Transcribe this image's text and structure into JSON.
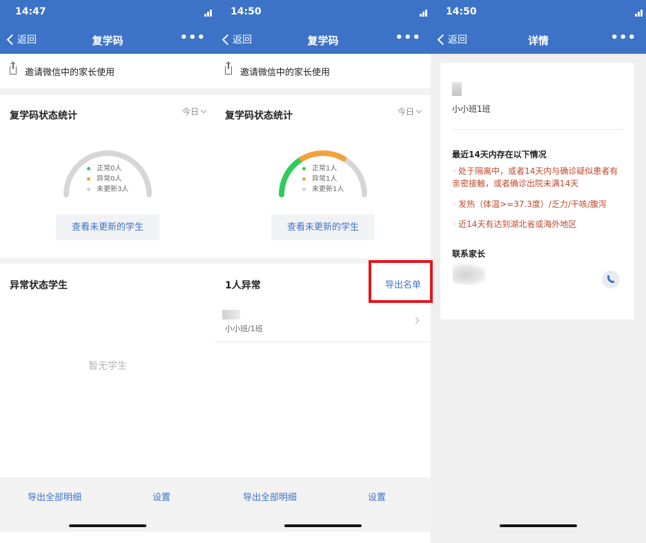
{
  "colors": {
    "brand": "#3c73c7",
    "normal": "#2ecc5a",
    "abnormal": "#f2a23a",
    "not_updated": "#d6d6d6",
    "alert": "#c0472a"
  },
  "screens": [
    {
      "time": "14:47",
      "nav": {
        "back": "返回",
        "title": "复学码",
        "more": "•••"
      },
      "invite": "邀请微信中的家长使用",
      "stats": {
        "title": "复学码状态统计",
        "range": "今日",
        "gauge": {
          "normal": 0,
          "abnormal": 0,
          "not_updated": 3
        },
        "legend": [
          "正常0人",
          "异常0人",
          "未更新3人"
        ],
        "button": "查看未更新的学生"
      },
      "abnormal": {
        "title": "异常状态学生",
        "empty": "暂无学生"
      },
      "bottom": {
        "export_all": "导出全部明细",
        "settings": "设置"
      }
    },
    {
      "time": "14:50",
      "nav": {
        "back": "返回",
        "title": "复学码",
        "more": "•••"
      },
      "invite": "邀请微信中的家长使用",
      "stats": {
        "title": "复学码状态统计",
        "range": "今日",
        "gauge": {
          "normal": 1,
          "abnormal": 1,
          "not_updated": 1
        },
        "legend": [
          "正常1人",
          "异常1人",
          "未更新1人"
        ],
        "button": "查看未更新的学生"
      },
      "abnormal": {
        "title": "1人异常",
        "export": "导出名单",
        "student_class": "小小班/1班"
      },
      "bottom": {
        "export_all": "导出全部明细",
        "settings": "设置"
      }
    },
    {
      "time": "14:50",
      "nav": {
        "back": "返回",
        "title": "详情",
        "more": "•••"
      },
      "detail": {
        "class": "小小班1班",
        "section_title": "最近14天内存在以下情况",
        "items": [
          "处于隔离中，或者14天内与确诊疑似患者有亲密接触，或者确诊出院未满14天",
          "发热（体温>=37.3度）/乏力/干咳/腹泻",
          "近14天有达到湖北省或海外地区"
        ],
        "bullet": "◦",
        "contact_title": "联系家长"
      }
    }
  ]
}
